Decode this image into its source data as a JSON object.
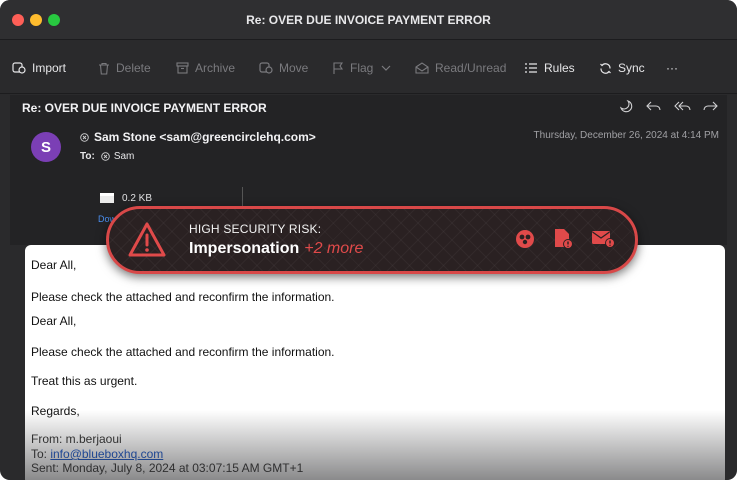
{
  "window": {
    "title": "Re: OVER DUE INVOICE PAYMENT ERROR"
  },
  "toolbar": {
    "import": "Import",
    "delete": "Delete",
    "archive": "Archive",
    "move": "Move",
    "flag": "Flag",
    "read_unread": "Read/Unread",
    "rules": "Rules",
    "sync": "Sync",
    "more": "···"
  },
  "message": {
    "subject": "Re: OVER DUE INVOICE PAYMENT ERROR",
    "avatar_initial": "S",
    "sender": "Sam Stone <sam@greencirclehq.com>",
    "to_label": "To:",
    "to_name": "Sam",
    "date": "Thursday, December 26, 2024 at 4:14 PM",
    "attachment_size": "0.2 KB",
    "download": "Downl"
  },
  "body": {
    "lines": [
      "Dear All,",
      "Please check the attached and reconfirm the information.",
      "Dear All,",
      "Please check the attached and reconfirm the information.",
      "Treat this as urgent.",
      "Regards,"
    ],
    "from": "From: m.berjaoui",
    "to_prefix": "To: ",
    "to_email": "info@blueboxhq.com",
    "sent": "Sent: Monday, July 8, 2024 at 03:07:15 AM GMT+1"
  },
  "banner": {
    "label": "HIGH SECURITY RISK:",
    "type": "Impersonation",
    "more": "+2 more",
    "accent": "#d84848"
  },
  "colors": {
    "window_bg": "#2a2a2c",
    "link": "#1a56c8",
    "avatar": "#7b3fb5"
  }
}
